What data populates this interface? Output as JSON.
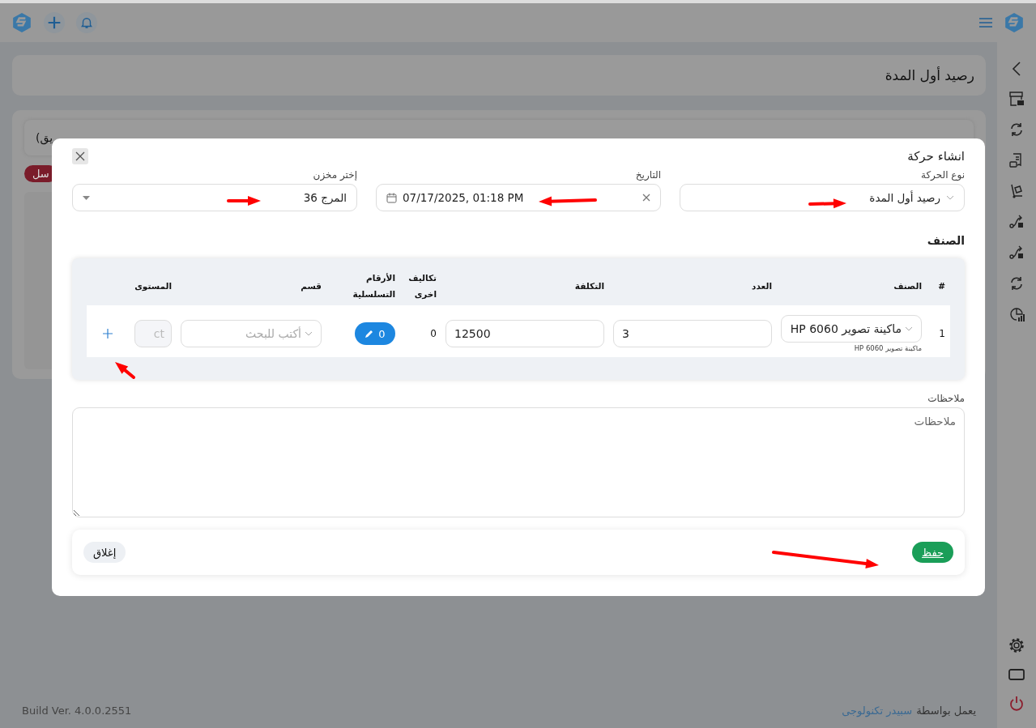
{
  "page": {
    "title": "رصيد أول المدة",
    "card_fragment": "يق)",
    "button_fragment": "سل"
  },
  "footer": {
    "powered_by": "يعمل بواسطة",
    "company_link": "سبيدر تكنولوجى",
    "build": "Build Ver. 4.0.0.2551"
  },
  "dialog": {
    "title": "انشاء حركة",
    "fields": [
      {
        "label": "نوع الحركة",
        "kind": "select",
        "value": "رصيد أول المدة"
      },
      {
        "label": "التاريخ",
        "kind": "date",
        "value": "07/17/2025, 01:18 PM"
      },
      {
        "label": "إختر مخزن",
        "kind": "dropdown",
        "value": "المرج 36"
      }
    ],
    "items_section": {
      "title": "الصنف",
      "columns": [
        "#",
        "الصنف",
        "العدد",
        "التكلفة",
        "تكاليف اخرى",
        "الأرقام التسلسلية",
        "قسم",
        "المستوى"
      ],
      "rows": [
        {
          "index": "1",
          "item": "ماكينة تصوير HP 6060",
          "item_caption": "ماكينة تصوير HP 6060",
          "quantity": "3",
          "cost": "12500",
          "other_costs": "0",
          "serials": "0",
          "section_placeholder": "أكتب للبحث",
          "level_placeholder": "ct"
        }
      ]
    },
    "notes": {
      "label": "ملاحظات",
      "placeholder": "ملاحظات"
    },
    "buttons": [
      {
        "label": "حفظ",
        "kind": "primary"
      },
      {
        "label": "إغلاق",
        "kind": "secondary"
      }
    ]
  }
}
